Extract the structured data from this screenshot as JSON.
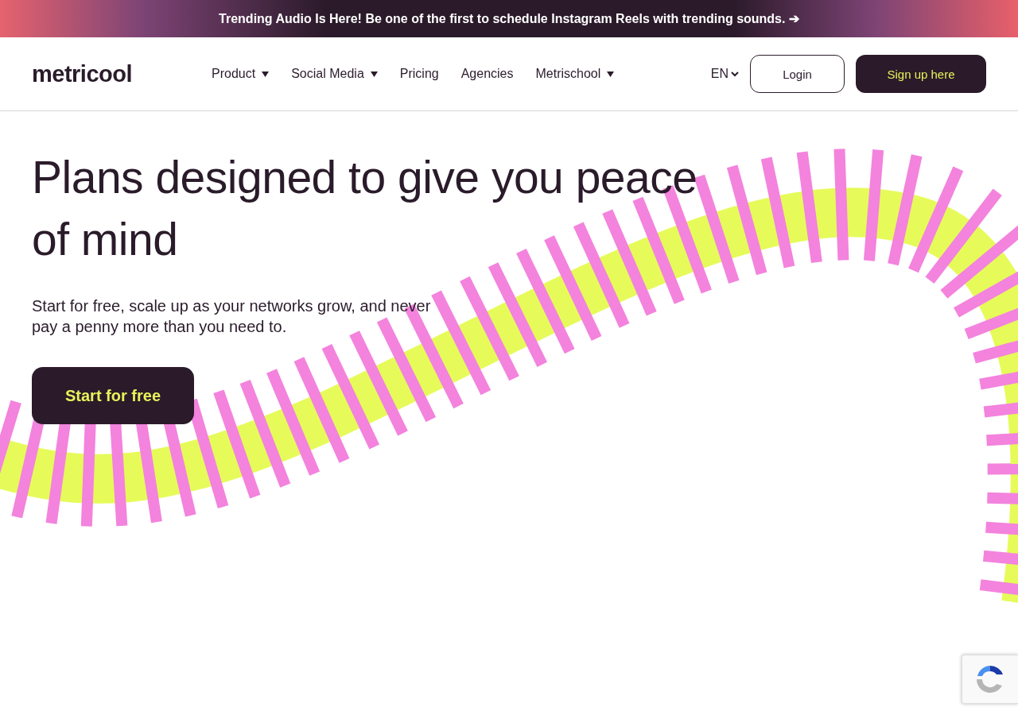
{
  "announcement": {
    "text": "Trending Audio Is Here! Be one of the first to schedule Instagram Reels with trending sounds. ➔"
  },
  "header": {
    "logo": "metricool",
    "nav": [
      {
        "label": "Product",
        "has_menu": true
      },
      {
        "label": "Social Media",
        "has_menu": true
      },
      {
        "label": "Pricing",
        "has_menu": false
      },
      {
        "label": "Agencies",
        "has_menu": false
      },
      {
        "label": "Metrischool",
        "has_menu": true
      }
    ],
    "language": "EN",
    "login": "Login",
    "signup": "Sign up here"
  },
  "hero": {
    "title": "Plans designed to give you peace of mind",
    "subtitle": "Start for free, scale up as your networks grow, and never pay a penny more than you need to.",
    "cta": "Start for free"
  }
}
